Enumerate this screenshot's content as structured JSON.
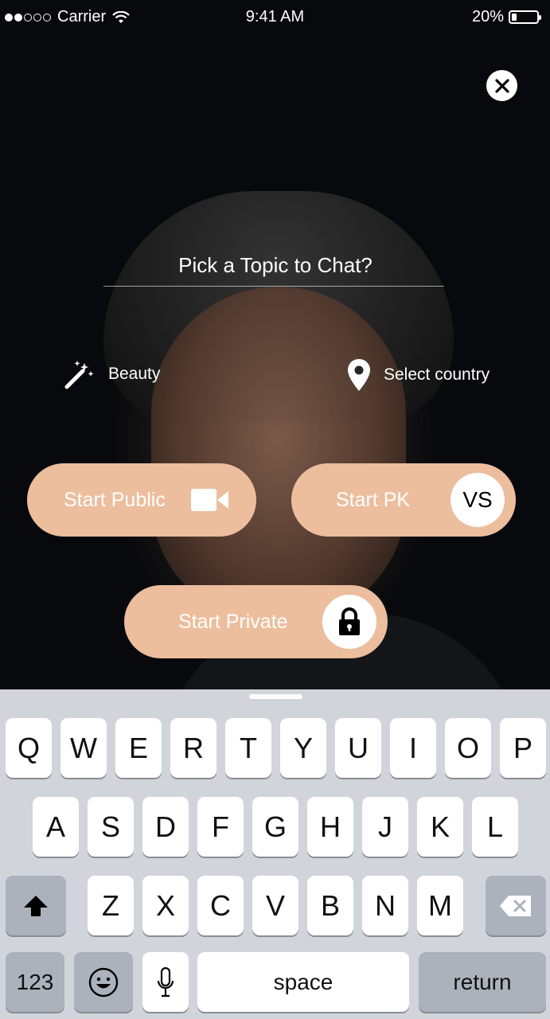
{
  "status_bar": {
    "carrier": "Carrier",
    "time": "9:41 AM",
    "battery": "20%",
    "battery_level": 0.2,
    "signal_bars_filled": 2,
    "signal_bars_total": 5
  },
  "close_icon": "close-icon",
  "topic": {
    "placeholder": "Pick a Topic to Chat?"
  },
  "options": {
    "beauty": {
      "label": "Beauty",
      "icon": "magic-wand-icon"
    },
    "country": {
      "label": "Select country",
      "icon": "location-pin-icon"
    }
  },
  "buttons": {
    "public": {
      "label": "Start Public",
      "icon": "video-camera-icon"
    },
    "pk": {
      "label": "Start PK",
      "badge": "VS"
    },
    "private": {
      "label": "Start Private",
      "icon": "lock-icon"
    }
  },
  "keyboard": {
    "row1": [
      "Q",
      "W",
      "E",
      "R",
      "T",
      "Y",
      "U",
      "I",
      "O",
      "P"
    ],
    "row2": [
      "A",
      "S",
      "D",
      "F",
      "G",
      "H",
      "J",
      "K",
      "L"
    ],
    "row3": [
      "Z",
      "X",
      "C",
      "V",
      "B",
      "N",
      "M"
    ],
    "numbers_key": "123",
    "space_key": "space",
    "return_key": "return"
  },
  "colors": {
    "button_fill": "#ecbe9d",
    "keyboard_bg": "#d1d4db",
    "dark_key": "#acb2bc"
  }
}
